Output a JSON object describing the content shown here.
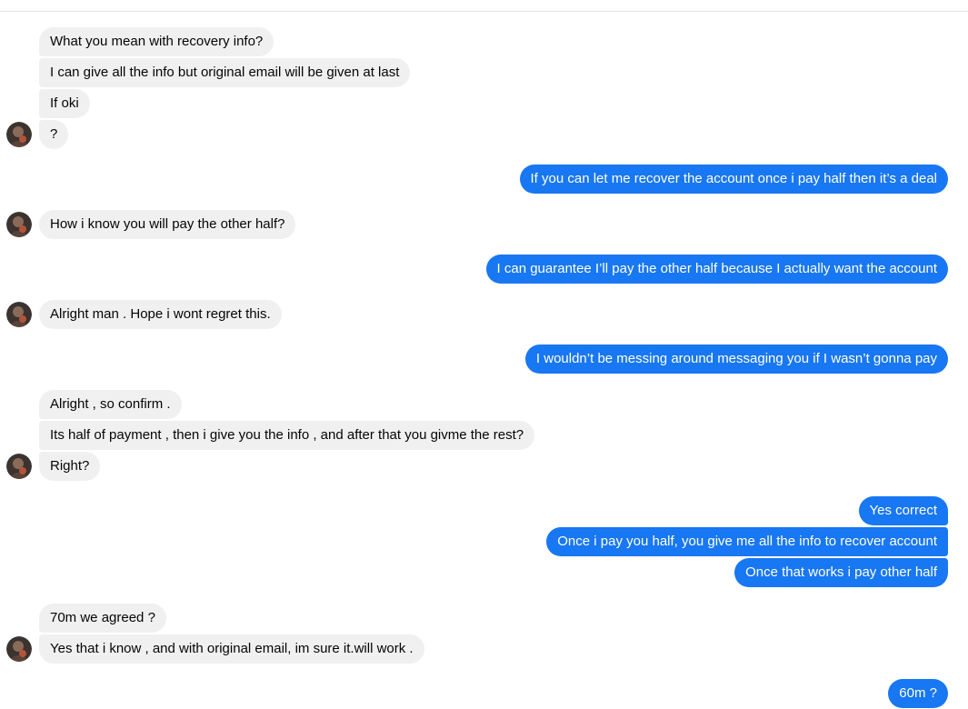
{
  "conversation": {
    "messages": [
      {
        "text": "What you mean with recovery info?"
      },
      {
        "text": "I can give all the info but original email will be given at last"
      },
      {
        "text": "If oki"
      },
      {
        "text": "?"
      },
      {
        "text": "If you can let me recover the account once i pay half then it’s a deal"
      },
      {
        "text": "How i know you will pay the other half?"
      },
      {
        "text": "I can guarantee I’ll pay the other half because I actually want the account"
      },
      {
        "text": "Alright man . Hope i wont regret this."
      },
      {
        "text": "I wouldn’t be messing around messaging you if I wasn’t gonna pay"
      },
      {
        "text": "Alright , so confirm ."
      },
      {
        "text": "Its half of payment , then i give you the info , and after that you givme the rest?"
      },
      {
        "text": "Right?"
      },
      {
        "text": "Yes correct"
      },
      {
        "text": "Once i pay you half, you give me all the info to recover account"
      },
      {
        "text": "Once that works i pay other half"
      },
      {
        "text": "70m we agreed ?"
      },
      {
        "text": "Yes that i know , and with original email, im sure it.will work ."
      },
      {
        "text": "60m ?"
      }
    ]
  },
  "colors": {
    "outgoing_bubble": "#1877f2",
    "incoming_bubble": "#f0f0f0"
  }
}
